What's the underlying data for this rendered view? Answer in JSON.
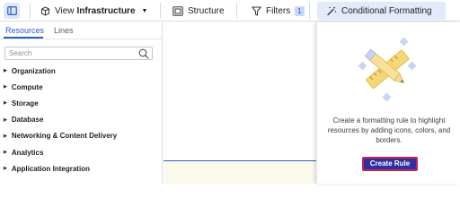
{
  "toolbar": {
    "view_label": "View",
    "view_value": "Infrastructure",
    "structure_label": "Structure",
    "filters_label": "Filters",
    "filters_count": "1",
    "conditional_formatting_label": "Conditional Formatting"
  },
  "left_panel": {
    "tabs": [
      {
        "label": "Resources",
        "active": true
      },
      {
        "label": "Lines",
        "active": false
      }
    ],
    "search_placeholder": "Search",
    "categories": [
      "Organization",
      "Compute",
      "Storage",
      "Database",
      "Networking & Content Delivery",
      "Analytics",
      "Application Integration"
    ]
  },
  "right_panel": {
    "description": "Create a formatting rule to highlight resources by adding icons, colors, and borders.",
    "create_rule_label": "Create Rule"
  },
  "colors": {
    "accent": "#2b5cc4",
    "button_bg": "#2e2fa0",
    "button_border": "#c0264f",
    "active_tab_bg": "#e3eafb",
    "illustration_yellow": "#f5d77a",
    "illustration_blue": "#c9d4f2"
  },
  "icons": {
    "sidebar_toggle": "sidebar-toggle-icon",
    "view": "cube-icon",
    "structure": "structure-icon",
    "filters": "filter-funnel-icon",
    "conditional_formatting": "magic-wand-icon",
    "search": "search-icon",
    "illustration": "ruler-pencil-icon"
  }
}
